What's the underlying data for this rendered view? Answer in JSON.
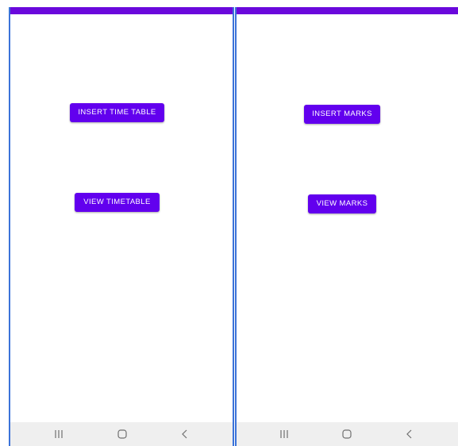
{
  "screens": [
    {
      "name": "timetable",
      "buttons": {
        "insert_label": "INSERT TIME TABLE",
        "view_label": "VIEW TIMETABLE"
      }
    },
    {
      "name": "marks",
      "buttons": {
        "insert_label": "INSERT MARKS",
        "view_label": "VIEW MARKS"
      }
    }
  ],
  "nav": {
    "icons": [
      "recent-apps-icon",
      "home-icon",
      "back-icon"
    ]
  },
  "colors": {
    "primary": "#6200ee",
    "status_bar": "#6a08dc",
    "nav_bar": "#efefef",
    "divider": "#3b73d9",
    "nav_icon": "#6f6f6f"
  }
}
